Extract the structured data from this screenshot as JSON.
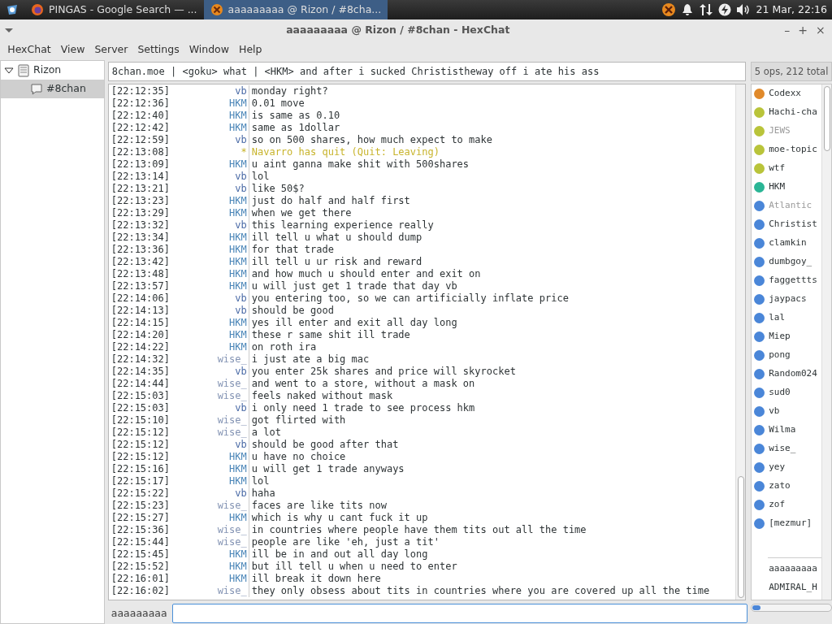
{
  "taskbar": {
    "tasks": [
      {
        "label": "PINGAS - Google Search — ...",
        "kind": "browser",
        "selected": false
      },
      {
        "label": "aaaaaaaaa @ Rizon / #8cha...",
        "kind": "chat",
        "selected": true
      }
    ],
    "clock": "21 Mar, 22:16"
  },
  "window": {
    "title": "aaaaaaaaa @ Rizon / #8chan - HexChat",
    "controls": [
      "–",
      "+",
      "×"
    ]
  },
  "menu": [
    "HexChat",
    "View",
    "Server",
    "Settings",
    "Window",
    "Help"
  ],
  "tree": [
    {
      "label": "Rizon",
      "expanded": true,
      "selected": false,
      "children": [
        {
          "label": "#8chan",
          "selected": true
        }
      ]
    }
  ],
  "topic": "8chan.moe | <goku> what | <HKM> and after i sucked Christistheway off i ate his ass",
  "user_count": "5 ops, 212 total",
  "messages": [
    {
      "time": "[22:12:35]",
      "nick": "vb",
      "color": "#4a6aa6",
      "kind": "message",
      "text": "monday right?"
    },
    {
      "time": "[22:12:36]",
      "nick": "HKM",
      "color": "#4b86b8",
      "kind": "message",
      "text": "0.01 move"
    },
    {
      "time": "[22:12:40]",
      "nick": "HKM",
      "color": "#4b86b8",
      "kind": "message",
      "text": "is same as 0.10"
    },
    {
      "time": "[22:12:42]",
      "nick": "HKM",
      "color": "#4b86b8",
      "kind": "message",
      "text": "same as 1dollar"
    },
    {
      "time": "[22:12:59]",
      "nick": "vb",
      "color": "#4a6aa6",
      "kind": "message",
      "text": "so on 500 shares, how much expect to make"
    },
    {
      "time": "[22:13:08]",
      "nick": "*",
      "color": "#c8b42c",
      "kind": "event",
      "text": "Navarro has quit (Quit: Leaving)"
    },
    {
      "time": "[22:13:09]",
      "nick": "HKM",
      "color": "#4b86b8",
      "kind": "message",
      "text": "u aint ganna make shit with 500shares"
    },
    {
      "time": "[22:13:14]",
      "nick": "vb",
      "color": "#4a6aa6",
      "kind": "message",
      "text": "lol"
    },
    {
      "time": "[22:13:21]",
      "nick": "vb",
      "color": "#4a6aa6",
      "kind": "message",
      "text": "like 50$?"
    },
    {
      "time": "[22:13:23]",
      "nick": "HKM",
      "color": "#4b86b8",
      "kind": "message",
      "text": "just do half and half first"
    },
    {
      "time": "[22:13:29]",
      "nick": "HKM",
      "color": "#4b86b8",
      "kind": "message",
      "text": "when we get there"
    },
    {
      "time": "[22:13:32]",
      "nick": "vb",
      "color": "#4a6aa6",
      "kind": "message",
      "text": "this learning experience really"
    },
    {
      "time": "[22:13:34]",
      "nick": "HKM",
      "color": "#4b86b8",
      "kind": "message",
      "text": "ill tell u what u should dump"
    },
    {
      "time": "[22:13:36]",
      "nick": "HKM",
      "color": "#4b86b8",
      "kind": "message",
      "text": "for that trade"
    },
    {
      "time": "[22:13:42]",
      "nick": "HKM",
      "color": "#4b86b8",
      "kind": "message",
      "text": "ill tell u ur risk and reward"
    },
    {
      "time": "[22:13:48]",
      "nick": "HKM",
      "color": "#4b86b8",
      "kind": "message",
      "text": "and how much u should enter and exit on"
    },
    {
      "time": "[22:13:57]",
      "nick": "HKM",
      "color": "#4b86b8",
      "kind": "message",
      "text": "u will just get 1 trade that day vb"
    },
    {
      "time": "[22:14:06]",
      "nick": "vb",
      "color": "#4a6aa6",
      "kind": "message",
      "text": "you entering too, so we can artificially inflate price"
    },
    {
      "time": "[22:14:13]",
      "nick": "vb",
      "color": "#4a6aa6",
      "kind": "message",
      "text": "should be good"
    },
    {
      "time": "[22:14:15]",
      "nick": "HKM",
      "color": "#4b86b8",
      "kind": "message",
      "text": "yes ill enter and exit all day long"
    },
    {
      "time": "[22:14:20]",
      "nick": "HKM",
      "color": "#4b86b8",
      "kind": "message",
      "text": "these r same shit ill trade"
    },
    {
      "time": "[22:14:22]",
      "nick": "HKM",
      "color": "#4b86b8",
      "kind": "message",
      "text": "on roth ira"
    },
    {
      "time": "[22:14:32]",
      "nick": "wise_",
      "color": "#8494b4",
      "kind": "message",
      "text": "i just ate a big mac"
    },
    {
      "time": "[22:14:35]",
      "nick": "vb",
      "color": "#4a6aa6",
      "kind": "message",
      "text": "you enter 25k shares and price will skyrocket"
    },
    {
      "time": "[22:14:44]",
      "nick": "wise_",
      "color": "#8494b4",
      "kind": "message",
      "text": "and went to a store, without a mask on"
    },
    {
      "time": "[22:15:03]",
      "nick": "wise_",
      "color": "#8494b4",
      "kind": "message",
      "text": "feels naked without mask"
    },
    {
      "time": "[22:15:03]",
      "nick": "vb",
      "color": "#4a6aa6",
      "kind": "message",
      "text": "i only need 1 trade to see process hkm"
    },
    {
      "time": "[22:15:10]",
      "nick": "wise_",
      "color": "#8494b4",
      "kind": "message",
      "text": "got flirted with"
    },
    {
      "time": "[22:15:12]",
      "nick": "wise_",
      "color": "#8494b4",
      "kind": "message",
      "text": "a lot"
    },
    {
      "time": "[22:15:12]",
      "nick": "vb",
      "color": "#4a6aa6",
      "kind": "message",
      "text": "should be good after that"
    },
    {
      "time": "[22:15:12]",
      "nick": "HKM",
      "color": "#4b86b8",
      "kind": "message",
      "text": "u have no choice"
    },
    {
      "time": "[22:15:16]",
      "nick": "HKM",
      "color": "#4b86b8",
      "kind": "message",
      "text": "u will get 1 trade anyways"
    },
    {
      "time": "[22:15:17]",
      "nick": "HKM",
      "color": "#4b86b8",
      "kind": "message",
      "text": "lol"
    },
    {
      "time": "[22:15:22]",
      "nick": "vb",
      "color": "#4a6aa6",
      "kind": "message",
      "text": "haha"
    },
    {
      "time": "[22:15:23]",
      "nick": "wise_",
      "color": "#8494b4",
      "kind": "message",
      "text": "faces are like tits now"
    },
    {
      "time": "[22:15:27]",
      "nick": "HKM",
      "color": "#4b86b8",
      "kind": "message",
      "text": "which is why u cant fuck it up"
    },
    {
      "time": "[22:15:36]",
      "nick": "wise_",
      "color": "#8494b4",
      "kind": "message",
      "text": "in countries where people have them tits out all the time"
    },
    {
      "time": "[22:15:44]",
      "nick": "wise_",
      "color": "#8494b4",
      "kind": "message",
      "text": "people are like 'eh, just a tit'"
    },
    {
      "time": "[22:15:45]",
      "nick": "HKM",
      "color": "#4b86b8",
      "kind": "message",
      "text": "ill be in and out all day long"
    },
    {
      "time": "[22:15:52]",
      "nick": "HKM",
      "color": "#4b86b8",
      "kind": "message",
      "text": "but ill tell u when u need to enter"
    },
    {
      "time": "[22:16:01]",
      "nick": "HKM",
      "color": "#4b86b8",
      "kind": "message",
      "text": "ill break it down here"
    },
    {
      "time": "[22:16:02]",
      "nick": "wise_",
      "color": "#8494b4",
      "kind": "message",
      "text": "they only obsess about tits in countries where you are covered up all the time"
    }
  ],
  "users": [
    {
      "nick": "Codexx",
      "color": "#e0892a",
      "away": false
    },
    {
      "nick": "Hachi-cha",
      "color": "#b9c43a",
      "away": false
    },
    {
      "nick": "JEWS",
      "color": "#b9c43a",
      "away": true
    },
    {
      "nick": "moe-topic",
      "color": "#b9c43a",
      "away": false
    },
    {
      "nick": "wtf",
      "color": "#b9c43a",
      "away": false
    },
    {
      "nick": "HKM",
      "color": "#2ab595",
      "away": false
    },
    {
      "nick": "Atlantic",
      "color": "#4a86d8",
      "away": true
    },
    {
      "nick": "Christist",
      "color": "#4a86d8",
      "away": false
    },
    {
      "nick": "clamkin",
      "color": "#4a86d8",
      "away": false
    },
    {
      "nick": "dumbgoy_",
      "color": "#4a86d8",
      "away": false
    },
    {
      "nick": "faggettts",
      "color": "#4a86d8",
      "away": false
    },
    {
      "nick": "jaypacs",
      "color": "#4a86d8",
      "away": false
    },
    {
      "nick": "lal",
      "color": "#4a86d8",
      "away": false
    },
    {
      "nick": "Miep",
      "color": "#4a86d8",
      "away": false
    },
    {
      "nick": "pong",
      "color": "#4a86d8",
      "away": false
    },
    {
      "nick": "Random024",
      "color": "#4a86d8",
      "away": false
    },
    {
      "nick": "sud0",
      "color": "#4a86d8",
      "away": false
    },
    {
      "nick": "vb",
      "color": "#4a86d8",
      "away": false
    },
    {
      "nick": "Wilma",
      "color": "#4a86d8",
      "away": false
    },
    {
      "nick": "wise_",
      "color": "#4a86d8",
      "away": false
    },
    {
      "nick": "yey",
      "color": "#4a86d8",
      "away": false
    },
    {
      "nick": "zato",
      "color": "#4a86d8",
      "away": false
    },
    {
      "nick": "zof",
      "color": "#4a86d8",
      "away": false
    },
    {
      "nick": "[mezmur]",
      "color": "#4a86d8",
      "away": false
    }
  ],
  "other_users": [
    "aaaaaaaaa",
    "ADMIRAL_H"
  ],
  "input": {
    "nick": "aaaaaaaaa"
  }
}
